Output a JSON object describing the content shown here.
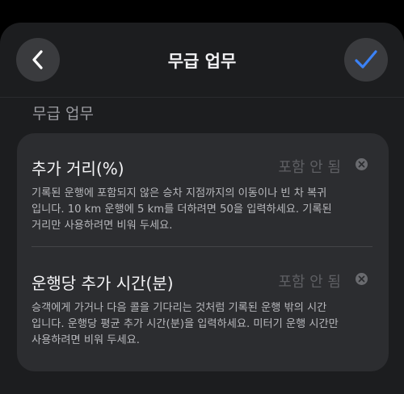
{
  "header": {
    "title": "무급 업무",
    "back_icon": "chevron-left-icon",
    "done_icon": "checkmark-icon",
    "accent_color": "#3b82f6"
  },
  "section": {
    "title": "무급 업무"
  },
  "fields": [
    {
      "label": "추가 거리(%)",
      "value": "포함 안 됨",
      "description": "기록된 운행에 포함되지 않은 승차 지점까지의 이동이나 빈 차 복귀\n입니다. 10 km 운행에 5 km를 더하려면 50을 입력하세요. 기록된\n거리만 사용하려면 비워 두세요."
    },
    {
      "label": "운행당 추가 시간(분)",
      "value": "포함 안 됨",
      "description": "승객에게 가거나 다음 콜을 기다리는 것처럼 기록된 운행 밖의 시간\n입니다. 운행당 평균 추가 시간(분)을 입력하세요. 미터기 운행 시간만\n사용하려면 비워 두세요."
    }
  ]
}
